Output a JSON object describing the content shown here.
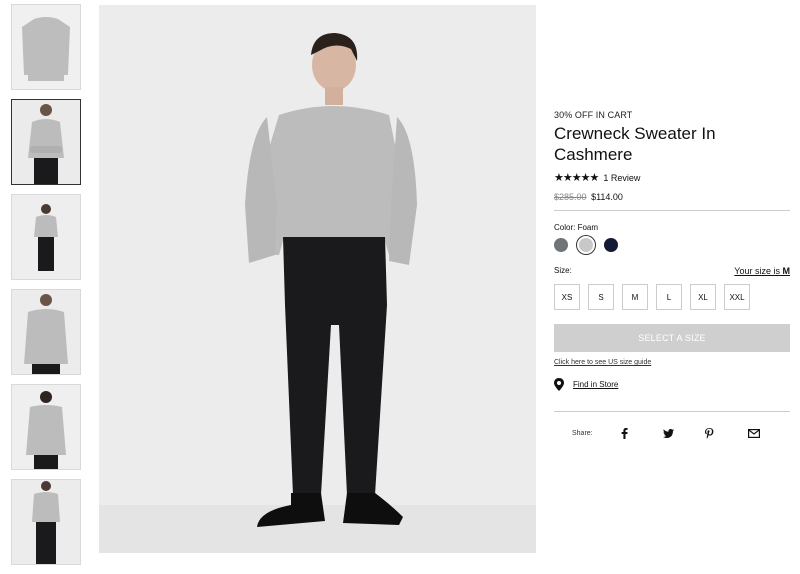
{
  "product": {
    "promo": "30% OFF IN CART",
    "title": "Crewneck Sweater In Cashmere",
    "rating_stars": "★★★★★",
    "rating_text": "1 Review",
    "price_old": "$285.00",
    "price_new": "$114.00",
    "color_label": "Color: Foam",
    "swatches": [
      {
        "name": "grey",
        "color": "#6e7478"
      },
      {
        "name": "foam",
        "color": "#c8c8c8"
      },
      {
        "name": "navy",
        "color": "#141a33"
      }
    ],
    "size_label": "Size:",
    "your_size_text": "Your size is",
    "your_size_value": "M",
    "sizes": [
      "XS",
      "S",
      "M",
      "L",
      "XL",
      "XXL"
    ],
    "cta_label": "SELECT A SIZE",
    "us_size_guide": "Click here to see US size guide",
    "find_in_store": "Find in Store",
    "share_label": "Share:",
    "share_icons": [
      "facebook-icon",
      "twitter-icon",
      "pinterest-icon",
      "email-icon"
    ]
  },
  "colors": {
    "sweater": "#bcbcbc",
    "pants": "#1a1a1c",
    "background": "#ececec"
  }
}
